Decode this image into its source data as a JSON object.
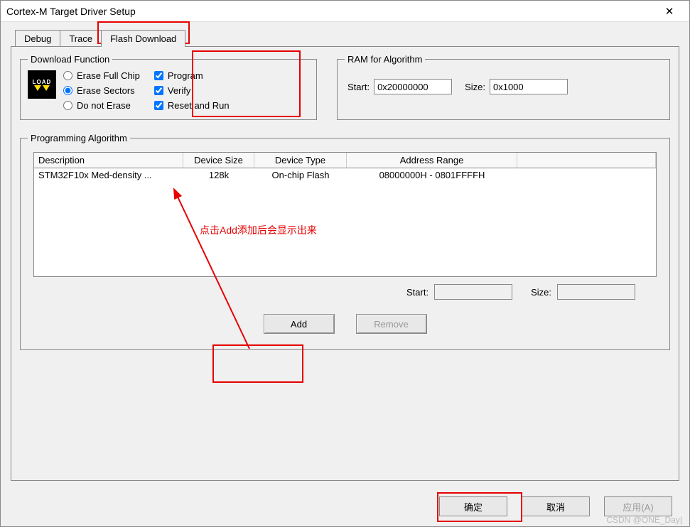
{
  "window": {
    "title": "Cortex-M Target Driver Setup"
  },
  "tabs": {
    "debug": "Debug",
    "trace": "Trace",
    "flash": "Flash Download"
  },
  "download": {
    "legend": "Download Function",
    "erase_full": "Erase Full Chip",
    "erase_sectors": "Erase Sectors",
    "do_not_erase": "Do not Erase",
    "program": "Program",
    "verify": "Verify",
    "reset_run": "Reset and Run",
    "load_text": "LOAD"
  },
  "ram": {
    "legend": "RAM for Algorithm",
    "start_label": "Start:",
    "start_value": "0x20000000",
    "size_label": "Size:",
    "size_value": "0x1000"
  },
  "prog": {
    "legend": "Programming Algorithm",
    "headers": {
      "desc": "Description",
      "size": "Device Size",
      "type": "Device Type",
      "range": "Address Range"
    },
    "row": {
      "desc": "STM32F10x Med-density ...",
      "size": "128k",
      "type": "On-chip Flash",
      "range": "08000000H - 0801FFFFH"
    },
    "start_label": "Start:",
    "start_value": "",
    "size_label": "Size:",
    "size_value": "",
    "add": "Add",
    "remove": "Remove"
  },
  "buttons": {
    "ok": "确定",
    "cancel": "取消",
    "apply": "应用(A)"
  },
  "annotation": "点击Add添加后会显示出来",
  "watermark": "CSDN @ONE_Day|"
}
